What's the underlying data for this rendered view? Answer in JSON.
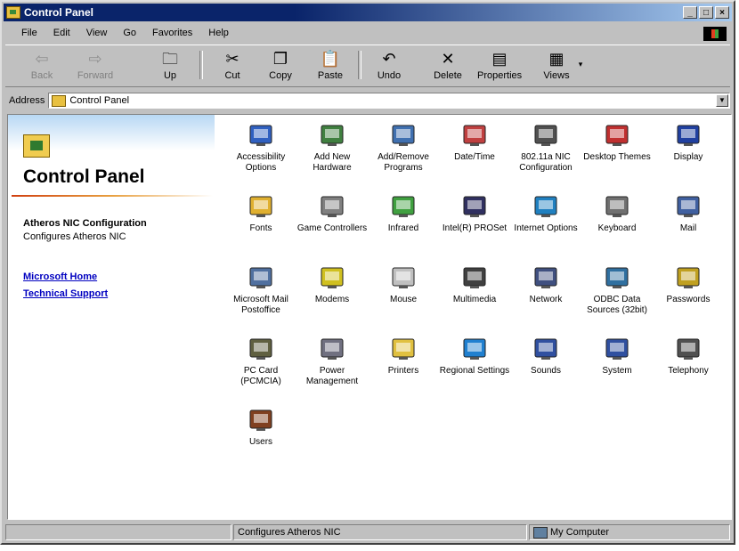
{
  "window": {
    "title": "Control Panel"
  },
  "menu": [
    "File",
    "Edit",
    "View",
    "Go",
    "Favorites",
    "Help"
  ],
  "toolbar": [
    {
      "label": "Back",
      "icon": "back-arrow-icon",
      "disabled": true
    },
    {
      "label": "Forward",
      "icon": "forward-arrow-icon",
      "disabled": true
    },
    {
      "label": "Up",
      "icon": "up-folder-icon",
      "disabled": false
    },
    {
      "label": "Cut",
      "icon": "scissors-icon",
      "disabled": false
    },
    {
      "label": "Copy",
      "icon": "copy-icon",
      "disabled": false
    },
    {
      "label": "Paste",
      "icon": "paste-icon",
      "disabled": false
    },
    {
      "label": "Undo",
      "icon": "undo-icon",
      "disabled": false
    },
    {
      "label": "Delete",
      "icon": "delete-x-icon",
      "disabled": false
    },
    {
      "label": "Properties",
      "icon": "properties-icon",
      "disabled": false
    },
    {
      "label": "Views",
      "icon": "views-icon",
      "disabled": false
    }
  ],
  "address": {
    "label": "Address",
    "value": "Control Panel"
  },
  "left_pane": {
    "title": "Control Panel",
    "selected_name": "Atheros NIC Configuration",
    "selected_desc": "Configures Atheros NIC",
    "links": [
      "Microsoft Home",
      "Technical Support"
    ]
  },
  "items": [
    {
      "label": "Accessibility Options",
      "icon": "accessibility-icon",
      "color": "#3060c0"
    },
    {
      "label": "Add New Hardware",
      "icon": "add-hardware-icon",
      "color": "#408040"
    },
    {
      "label": "Add/Remove Programs",
      "icon": "add-remove-programs-icon",
      "color": "#4070b0"
    },
    {
      "label": "Date/Time",
      "icon": "date-time-icon",
      "color": "#c04040"
    },
    {
      "label": "802.11a NIC Configuration",
      "icon": "network-config-icon",
      "color": "#505050"
    },
    {
      "label": "Desktop Themes",
      "icon": "desktop-themes-icon",
      "color": "#c03030"
    },
    {
      "label": "Display",
      "icon": "display-icon",
      "color": "#2040a0"
    },
    {
      "label": "Fonts",
      "icon": "fonts-folder-icon",
      "color": "#e0b030"
    },
    {
      "label": "Game Controllers",
      "icon": "joystick-icon",
      "color": "#808080"
    },
    {
      "label": "Infrared",
      "icon": "infrared-icon",
      "color": "#40a040"
    },
    {
      "label": "Intel(R) PROSet",
      "icon": "intel-proset-icon",
      "color": "#303060"
    },
    {
      "label": "Internet Options",
      "icon": "internet-options-icon",
      "color": "#2080c0"
    },
    {
      "label": "Keyboard",
      "icon": "keyboard-icon",
      "color": "#707070"
    },
    {
      "label": "Mail",
      "icon": "mail-icon",
      "color": "#4060a0"
    },
    {
      "label": "Microsoft Mail Postoffice",
      "icon": "mail-postoffice-icon",
      "color": "#5070a0"
    },
    {
      "label": "Modems",
      "icon": "modem-phone-icon",
      "color": "#d0c020"
    },
    {
      "label": "Mouse",
      "icon": "mouse-icon",
      "color": "#c0c0c0"
    },
    {
      "label": "Multimedia",
      "icon": "multimedia-icon",
      "color": "#404040"
    },
    {
      "label": "Network",
      "icon": "network-icon",
      "color": "#405080"
    },
    {
      "label": "ODBC Data Sources (32bit)",
      "icon": "odbc-icon",
      "color": "#3070a0"
    },
    {
      "label": "Passwords",
      "icon": "keys-icon",
      "color": "#c0a020"
    },
    {
      "label": "PC Card (PCMCIA)",
      "icon": "pc-card-icon",
      "color": "#606040"
    },
    {
      "label": "Power Management",
      "icon": "power-management-icon",
      "color": "#707080"
    },
    {
      "label": "Printers",
      "icon": "printers-folder-icon",
      "color": "#e0c040"
    },
    {
      "label": "Regional Settings",
      "icon": "globe-icon",
      "color": "#2080d0"
    },
    {
      "label": "Sounds",
      "icon": "sounds-icon",
      "color": "#3050a0"
    },
    {
      "label": "System",
      "icon": "system-computer-icon",
      "color": "#3050a0"
    },
    {
      "label": "Telephony",
      "icon": "telephony-icon",
      "color": "#505050"
    },
    {
      "label": "Users",
      "icon": "users-icon",
      "color": "#804020"
    }
  ],
  "status": {
    "left": "",
    "middle": "Configures Atheros NIC",
    "right": "My Computer"
  }
}
